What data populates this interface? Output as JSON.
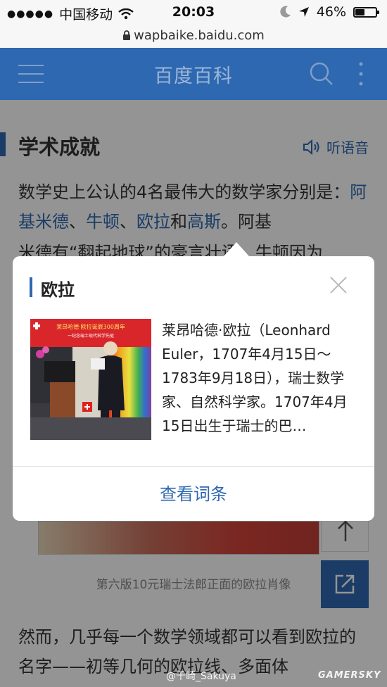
{
  "status_bar": {
    "carrier": "中国移动",
    "time": "20:03",
    "battery": "46%",
    "battery_level": 0.46
  },
  "url_bar": {
    "url": "wapbaike.baidu.com"
  },
  "header": {
    "title": "百度百科"
  },
  "section": {
    "title": "学术成就",
    "listen_label": "听语音"
  },
  "para1": {
    "prefix": "数学史上公认的4名最伟大的数学家分别是：",
    "link1": "阿基米德",
    "sep1": "、",
    "link2": "牛顿",
    "sep2": "、",
    "link3": "欧拉",
    "and": "和",
    "link4": "高斯",
    "suffix": "。阿基",
    "overflow": "米德有“翻起地球”的豪言壮语，牛顿因为"
  },
  "image_caption": "第六版10元瑞士法郎正面的欧拉肖像",
  "para2": "然而，几乎每一个数学领域都可以看到欧拉的名字——初等几何的欧拉线、多面体",
  "popup": {
    "title": "欧拉",
    "description": "莱昂哈德·欧拉（Leonhard Euler，1707年4月15日～1783年9月18日），瑞士数学家、自然科学家。1707年4月15日出生于瑞士的巴…",
    "thumb_banner": "莱昂哈德·欧拉诞辰300周年",
    "thumb_subbanner": "一纪念瑞士现代科学先驱",
    "view_button": "查看词条"
  },
  "watermark": "@千崎_Sakuya",
  "watermark2": "GAMERSKY",
  "colors": {
    "brand_blue": "#2e68b0"
  }
}
